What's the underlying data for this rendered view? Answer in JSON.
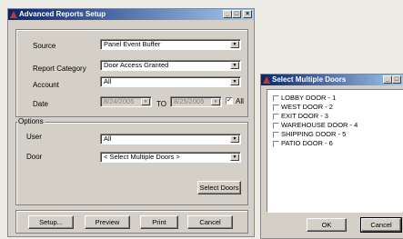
{
  "main_window": {
    "title": "Advanced Reports Setup",
    "source_label": "Source",
    "source_value": "Panel Event Buffer",
    "report_category_label": "Report Category",
    "report_category_value": "Door Access Granted",
    "account_label": "Account",
    "account_value": "All",
    "date_label": "Date",
    "date_from": "8/24/2005",
    "date_to_label": "TO",
    "date_to": "8/25/2005",
    "all_label": "All",
    "options_label": "Options",
    "user_label": "User",
    "user_value": "All",
    "door_label": "Door",
    "door_value": "< Select Multiple Doors >",
    "select_doors_button": "Select Doors",
    "setup_button": "Setup...",
    "preview_button": "Preview",
    "print_button": "Print",
    "cancel_button": "Cancel"
  },
  "doors_window": {
    "title": "Select Multiple Doors",
    "doors": [
      "LOBBY DOOR - 1",
      "WEST DOOR - 2",
      "EXIT DOOR - 3",
      "WAREHOUSE DOOR - 4",
      "SHIPPING DOOR - 5",
      "PATIO DOOR - 6"
    ],
    "ok_button": "OK",
    "cancel_button": "Cancel"
  }
}
